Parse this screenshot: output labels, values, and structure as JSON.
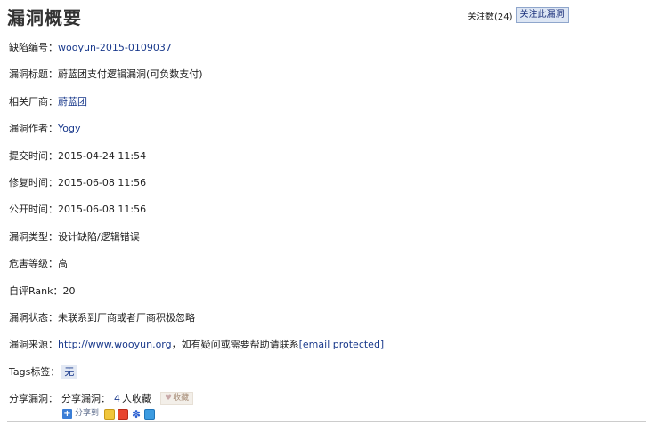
{
  "header": {
    "title": "漏洞概要",
    "follow_count_text": "关注数(24)",
    "follow_button": "关注此漏洞"
  },
  "fields": {
    "bug_id": {
      "label": "缺陷编号：",
      "value": "wooyun-2015-0109037"
    },
    "bug_title": {
      "label": "漏洞标题：",
      "value": "蔚蓝团支付逻辑漏洞(可负数支付)"
    },
    "vendor": {
      "label": "相关厂商：",
      "value": "蔚蓝团"
    },
    "author": {
      "label": "漏洞作者：",
      "value": "Yogy"
    },
    "submit_time": {
      "label": "提交时间：",
      "value": "2015-04-24 11:54"
    },
    "fix_time": {
      "label": "修复时间：",
      "value": "2015-06-08 11:56"
    },
    "public_time": {
      "label": "公开时间：",
      "value": "2015-06-08 11:56"
    },
    "bug_type": {
      "label": "漏洞类型：",
      "value": "设计缺陷/逻辑错误"
    },
    "danger_level": {
      "label": "危害等级：",
      "value": "高"
    },
    "rank": {
      "label": "自评Rank：",
      "value": "20"
    },
    "status": {
      "label": "漏洞状态：",
      "value": "未联系到厂商或者厂商积极忽略"
    },
    "source": {
      "label": "漏洞来源：",
      "link": "http://www.wooyun.org",
      "text": "，如有疑问或需要帮助请联系 ",
      "email": "[email protected]"
    },
    "tags": {
      "label": "Tags标签：",
      "value": "无"
    },
    "share": {
      "label": "分享漏洞：",
      "inner_label": "分享漏洞：",
      "count": "4",
      "count_suffix": "人收藏",
      "fav_button": "收藏",
      "share_to": "分享到"
    }
  },
  "icons": {
    "heart": "heart-icon",
    "share_plus": "share-plus-icon",
    "qzone": "qzone-icon",
    "weibo": "sina-weibo-icon",
    "baidu": "baidu-paw-icon",
    "tqq": "tencent-weibo-icon"
  },
  "colors": {
    "link": "#1a3a8c",
    "follow_button_bg": "#dde6f4",
    "tag_bg": "#e3e9f4"
  }
}
